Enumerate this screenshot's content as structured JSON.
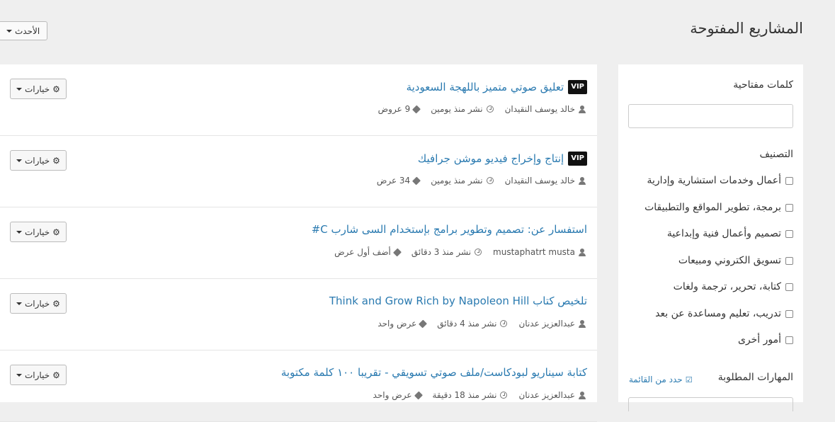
{
  "header": {
    "title": "المشاريع المفتوحة",
    "sort_label": "الأحدث"
  },
  "projects": [
    {
      "vip": "VIP",
      "title": "تعليق صوتي متميز باللهجة السعودية",
      "author": "خالد يوسف النقيدان",
      "time": "نشر منذ يومين",
      "offers": "9 عروض",
      "options": "خيارات"
    },
    {
      "vip": "VIP",
      "title": "إنتاج وإخراج فيديو موشن جرافيك",
      "author": "خالد يوسف النقيدان",
      "time": "نشر منذ يومين",
      "offers": "34 عرض",
      "options": "خيارات"
    },
    {
      "vip": "",
      "title": "استفسار عن: تصميم وتطوير برامج بإستخدام السى شارب C#",
      "author": "mustaphatrt musta",
      "time": "نشر منذ 3 دقائق",
      "offers": "أضف أول عرض",
      "options": "خيارات"
    },
    {
      "vip": "",
      "title": "تلخيص كتاب Think and Grow Rich by Napoleon Hill",
      "author": "عبدالعزيز عدنان",
      "time": "نشر منذ 4 دقائق",
      "offers": "عرض واحد",
      "options": "خيارات"
    },
    {
      "vip": "",
      "title": "كتابة سيناريو لبودكاست/ملف صوتي تسويقي - تقريبا ١٠٠ كلمة مكتوبة",
      "author": "عبدالعزيز عدنان",
      "time": "نشر منذ 18 دقيقة",
      "offers": "عرض واحد",
      "options": "خيارات"
    }
  ],
  "sidebar": {
    "keywords_label": "كلمات مفتاحية",
    "keywords_value": "",
    "category_label": "التصنيف",
    "categories": [
      "أعمال وخدمات استشارية وإدارية",
      "برمجة، تطوير المواقع والتطبيقات",
      "تصميم وأعمال فنية وإبداعية",
      "تسويق الكتروني ومبيعات",
      "كتابة، تحرير، ترجمة ولغات",
      "تدريب، تعليم ومساعدة عن بعد",
      "أمور أخرى"
    ],
    "skills_label": "المهارات المطلوبة",
    "select_from_list": "حدد من القائمة"
  }
}
